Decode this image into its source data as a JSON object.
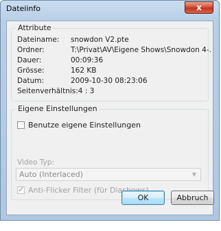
{
  "window": {
    "title": "Dateiinfo",
    "close_label": "x"
  },
  "attribute": {
    "legend": "Attribute",
    "rows": [
      {
        "label": "Dateiname:",
        "value": "snowdon V2.pte"
      },
      {
        "label": "Ordner:",
        "value": "T:\\Privat\\AV\\Eigene Shows\\Snowdon 4-."
      },
      {
        "label": "Dauer:",
        "value": "00:09:36"
      },
      {
        "label": "Grösse:",
        "value": "162 KB"
      },
      {
        "label": "Datum:",
        "value": "2009-10-30  08:23:06"
      },
      {
        "label": "Seitenverhältnis:",
        "value": "4 : 3"
      }
    ]
  },
  "settings": {
    "legend": "Eigene Einstellungen",
    "use_own_label": "Benutze eigene Einstellungen",
    "use_own_checked": false,
    "video_type_label": "Video Typ:",
    "video_type_value": "Auto (Interlaced)",
    "anti_flicker_label": "Anti-Flicker Filter (für Diashows)",
    "anti_flicker_checked": true
  },
  "buttons": {
    "ok": "OK",
    "cancel": "Abbruch"
  },
  "icons": {
    "close": "close-icon",
    "dropdown": "chevron-down-icon",
    "check": "checkmark-icon"
  }
}
